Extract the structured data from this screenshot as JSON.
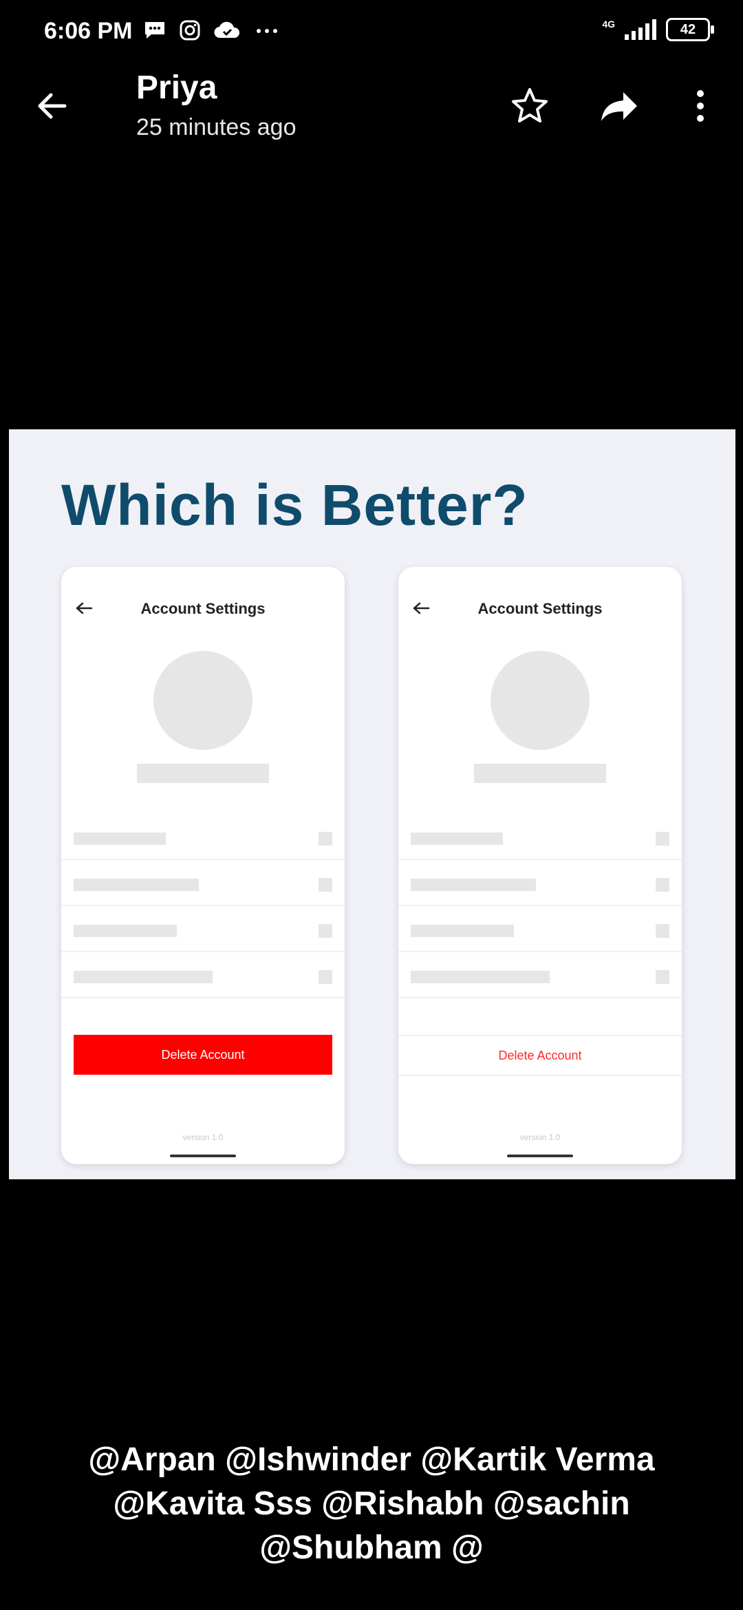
{
  "status_bar": {
    "time": "6:06 PM",
    "network": "4G",
    "battery": "42",
    "notification_icons": [
      "message-icon",
      "instagram-icon",
      "cloud-icon",
      "more-dots-icon"
    ]
  },
  "header": {
    "sender": "Priya",
    "timestamp": "25 minutes ago",
    "icons": [
      "back-arrow-icon",
      "star-icon",
      "share-icon",
      "overflow-menu-icon"
    ]
  },
  "image": {
    "heading": "Which is Better?",
    "phones": [
      {
        "title": "Account Settings",
        "button": "Delete Account",
        "button_style": "filled-red",
        "version": "version 1.0"
      },
      {
        "title": "Account Settings",
        "button": "Delete Account",
        "button_style": "text-red",
        "version": "version 1.0"
      }
    ]
  },
  "caption": {
    "lines": [
      "@Arpan @Ishwinder @Kartik Verma",
      "@Kavita Sss @Rishabh @sachin",
      "@Shubham @"
    ]
  },
  "colors": {
    "background": "#000000",
    "heading": "#0f4c6b",
    "danger": "#ff0000",
    "image_bg": "#f0f0f7"
  }
}
